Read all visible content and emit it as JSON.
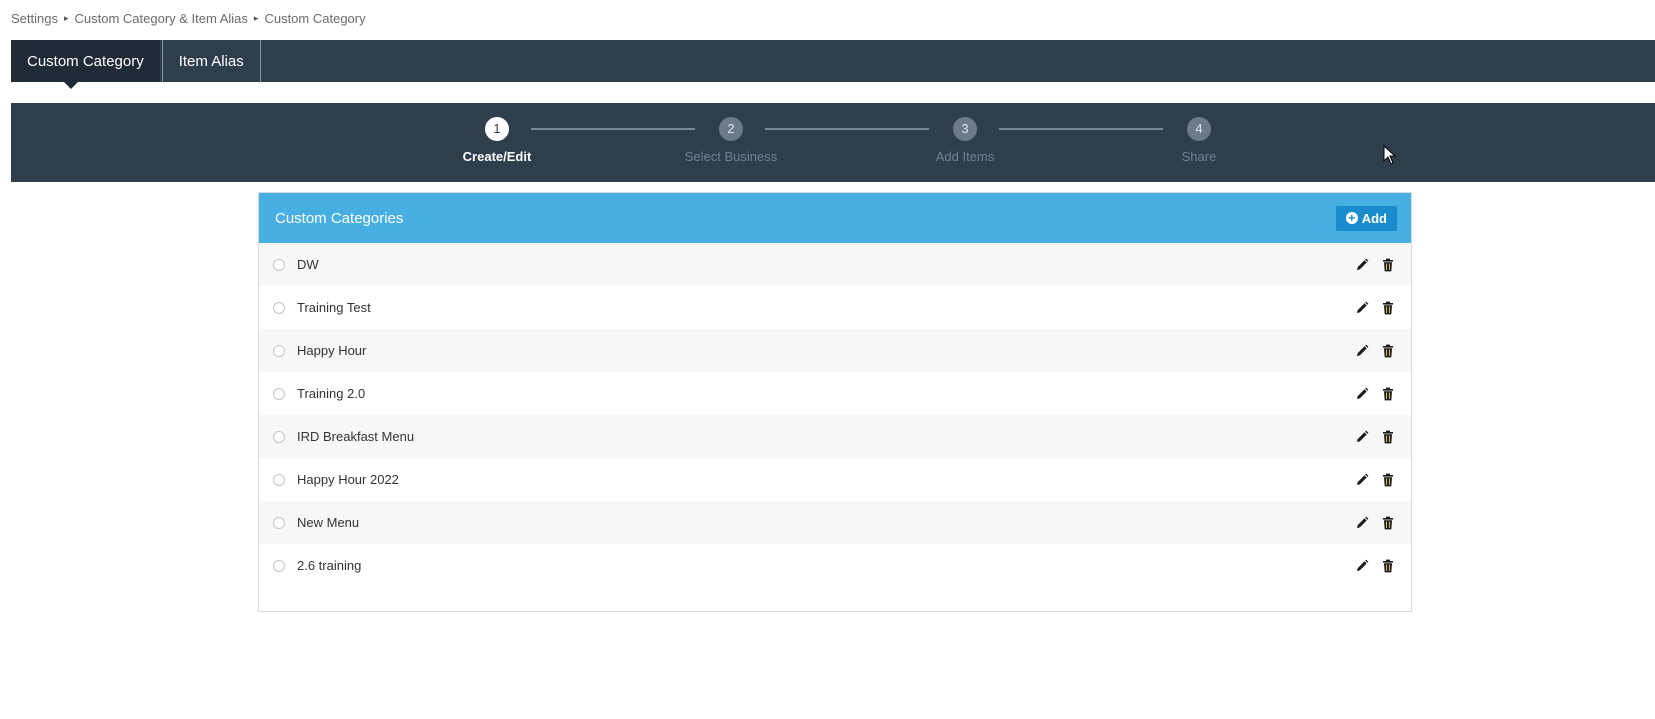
{
  "breadcrumb": {
    "items": [
      "Settings",
      "Custom Category & Item Alias",
      "Custom Category"
    ],
    "separator": "▸"
  },
  "tabs": [
    {
      "label": "Custom Category",
      "active": true
    },
    {
      "label": "Item Alias",
      "active": false
    }
  ],
  "stepper": {
    "steps": [
      {
        "number": "1",
        "label": "Create/Edit",
        "active": true
      },
      {
        "number": "2",
        "label": "Select Business",
        "active": false
      },
      {
        "number": "3",
        "label": "Add Items",
        "active": false
      },
      {
        "number": "4",
        "label": "Share",
        "active": false
      }
    ]
  },
  "panel": {
    "title": "Custom Categories",
    "add_label": "Add",
    "header_color": "#47afe2",
    "rows": [
      {
        "label": "DW"
      },
      {
        "label": "Training Test"
      },
      {
        "label": "Happy Hour"
      },
      {
        "label": "Training 2.0"
      },
      {
        "label": "IRD Breakfast Menu"
      },
      {
        "label": "Happy Hour 2022"
      },
      {
        "label": "New Menu"
      },
      {
        "label": "2.6 training"
      }
    ],
    "row_icons": [
      "pencil-icon",
      "trash-icon"
    ]
  },
  "colors": {
    "nav_bg": "#2f3e4d",
    "tab_active_bg": "#1f2b37",
    "add_button_bg": "#1a8ccd"
  }
}
